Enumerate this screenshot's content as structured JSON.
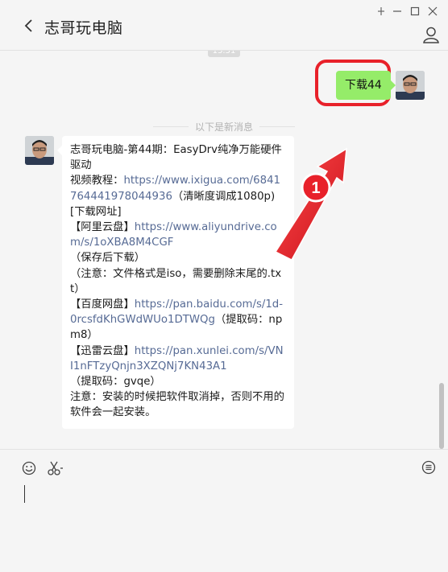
{
  "window": {
    "title": "志哥玩电脑",
    "icons": [
      "chevron-left-icon",
      "pin-icon",
      "minimize-icon",
      "maximize-icon",
      "close-icon",
      "profile-icon"
    ]
  },
  "chat": {
    "timestamp": "13:51",
    "sent_message": "下载44",
    "new_messages_divider": "以下是新消息",
    "callout_number": "1",
    "received_message": {
      "title": "志哥玩电脑-第44期：EasyDrv纯净万能硬件驱动",
      "video_label": "视频教程：",
      "video_link": "https://www.ixigua.com/6841764441978044936",
      "video_note": "（清晰度调成1080p)",
      "download_header": "[下载网址]",
      "aliyun_label": "【阿里云盘】",
      "aliyun_link": "https://www.aliyundrive.com/s/1oXBA8M4CGF",
      "aliyun_note": "（保存后下载）",
      "file_note": "（注意：文件格式是iso，需要删除末尾的.txt）",
      "baidu_label": "【百度网盘】",
      "baidu_link": "https://pan.baidu.com/s/1d-0rcsfdKhGWdWUo1DTWQg",
      "baidu_code": "（提取码：npm8）",
      "xunlei_label": "【迅雷云盘】",
      "xunlei_link": "https://pan.xunlei.com/s/VNI1nFTzyQnjn3XZQNj7KN43A1",
      "xunlei_code": "（提取码：gvqe）",
      "warning": "注意：安装的时候把软件取消掉，否则不用的软件会一起安装。"
    }
  },
  "composer": {
    "icons": [
      "emoji-icon",
      "scissors-icon",
      "chat-history-icon"
    ]
  },
  "colors": {
    "sent_bubble": "#95ec69",
    "link": "#576b95",
    "highlight": "#e8212a"
  }
}
